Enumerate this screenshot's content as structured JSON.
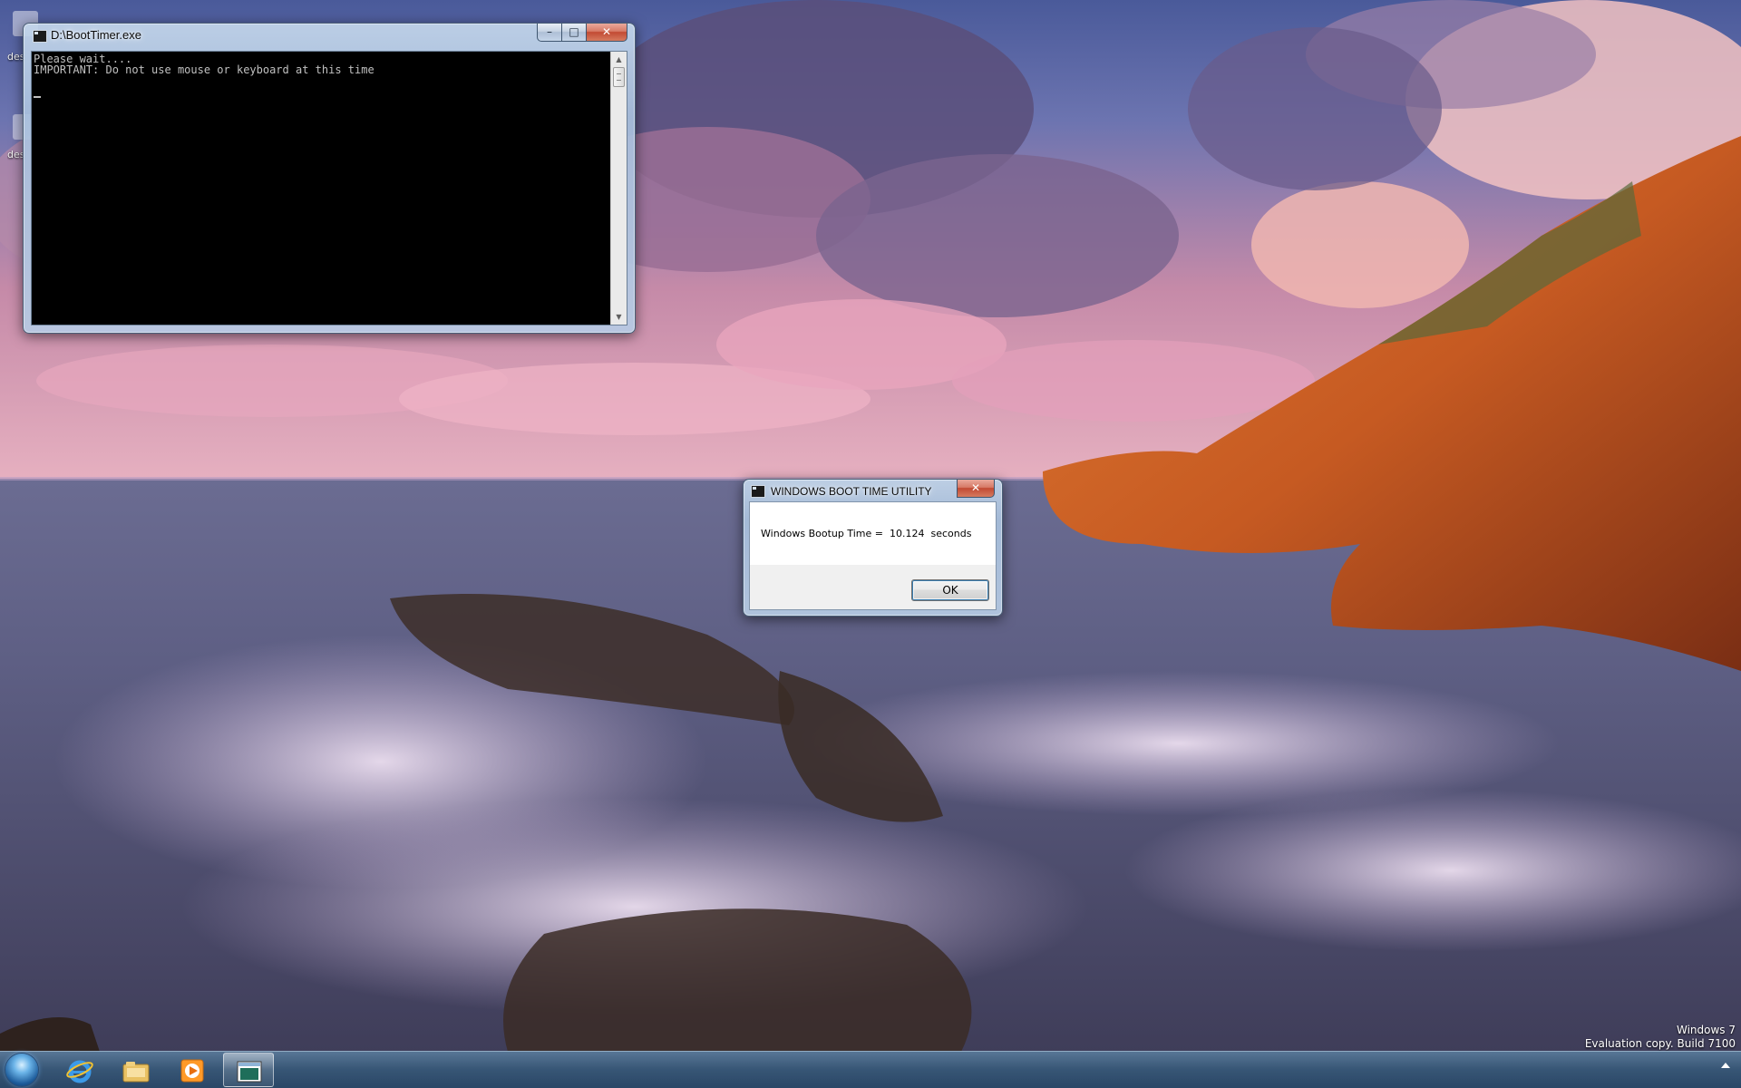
{
  "desktop": {
    "icon_labels": [
      "des",
      "des"
    ]
  },
  "console_window": {
    "title": "D:\\BootTimer.exe",
    "lines": [
      "Please wait....",
      "IMPORTANT: Do not use mouse or keyboard at this time"
    ],
    "controls": {
      "minimize": "–",
      "maximize": "□",
      "close": "✕"
    }
  },
  "message_box": {
    "title": "WINDOWS BOOT TIME UTILITY",
    "message": "Windows Bootup Time =  10.124  seconds",
    "close": "✕",
    "ok_label": "OK"
  },
  "watermark": {
    "line1": "Windows 7",
    "line2": "Evaluation copy. Build 7100"
  },
  "taskbar": {
    "items": [
      {
        "name": "start-button",
        "icon": "windows-orb-icon"
      },
      {
        "name": "internet-explorer",
        "icon": "internet-explorer-icon"
      },
      {
        "name": "windows-explorer",
        "icon": "folder-library-icon"
      },
      {
        "name": "media-player",
        "icon": "media-player-icon"
      },
      {
        "name": "console-window",
        "icon": "console-window-icon",
        "active": true
      }
    ],
    "tray": {
      "icon": "show-hidden-icons-icon"
    }
  },
  "colors": {
    "console_bg": "#000000",
    "console_text": "#c0c0c0",
    "close_button": "#c24a33",
    "taskbar": "#365878"
  }
}
